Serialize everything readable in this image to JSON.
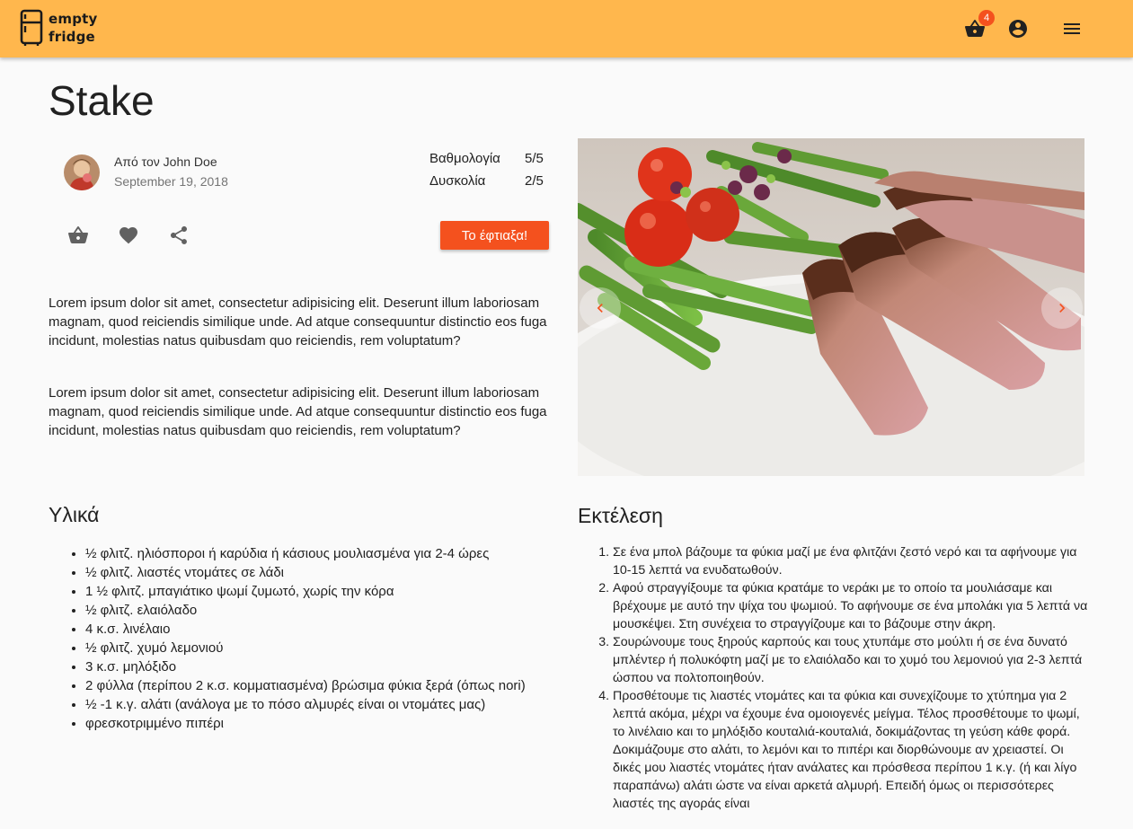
{
  "header": {
    "logo_line1": "empty",
    "logo_line2": "fridge",
    "cart_count": "4",
    "brand_color": "#ffb74d",
    "accent_color": "#f4511e",
    "icons": [
      "fridge-icon",
      "basket-icon",
      "account-icon",
      "menu-icon"
    ]
  },
  "recipe": {
    "title": "Stake",
    "author": "Από τον John Doe",
    "date": "September 19, 2018",
    "rating_label": "Βαθμολογία",
    "rating_value": "5/5",
    "difficulty_label": "Δυσκολία",
    "difficulty_value": "2/5",
    "made_it_label": "Το έφτιαξα!",
    "action_icons": [
      "basket-icon",
      "heart-icon",
      "share-icon"
    ],
    "description": [
      "Lorem ipsum dolor sit amet, consectetur adipisicing elit. Deserunt illum laboriosam magnam, quod reiciendis similique unde. Ad atque consequuntur distinctio eos fuga incidunt, molestias natus quibusdam quo reiciendis, rem voluptatum?",
      "Lorem ipsum dolor sit amet, consectetur adipisicing elit. Deserunt illum laboriosam magnam, quod reiciendis similique unde. Ad atque consequuntur distinctio eos fuga incidunt, molestias natus quibusdam quo reiciendis, rem voluptatum?"
    ]
  },
  "ingredients": {
    "heading": "Υλικά",
    "items": [
      "½ φλιτζ. ηλιόσποροι ή καρύδια ή κάσιους μουλιασμένα για 2-4 ώρες",
      "½ φλιτζ. λιαστές ντομάτες σε λάδι",
      "1 ½ φλιτζ. μπαγιάτικο ψωμί ζυμωτό, χωρίς την κόρα",
      "½ φλιτζ. ελαιόλαδο",
      "4 κ.σ. λινέλαιο",
      "½ φλιτζ. χυμό λεμονιού",
      "3 κ.σ. μηλόξιδο",
      "2 φύλλα (περίπου 2 κ.σ. κομματιασμένα) βρώσιμα φύκια ξερά (όπως nori)",
      "½ -1 κ.γ. αλάτι (ανάλογα με το πόσο αλμυρές είναι οι ντομάτες μας)",
      "φρεσκοτριμμένο πιπέρι"
    ]
  },
  "execution": {
    "heading": "Εκτέλεση",
    "steps": [
      "Σε ένα μπολ βάζουμε τα φύκια μαζί με ένα φλιτζάνι ζεστό νερό και τα αφήνουμε για 10-15 λεπτά να ενυδατωθούν.",
      "Αφού στραγγίξουμε τα φύκια κρατάμε το νεράκι με το οποίο τα μουλιάσαμε και βρέχουμε με αυτό την ψίχα του ψωμιού. Το αφήνουμε σε ένα μπολάκι για 5 λεπτά να μουσκέψει. Στη συνέχεια το στραγγίζουμε και το βάζουμε στην άκρη.",
      "Σουρώνουμε τους ξηρούς καρπούς και τους χτυπάμε στο μούλτι ή σε ένα δυνατό μπλέντερ ή πολυκόφτη μαζί με το ελαιόλαδο και το χυμό του λεμονιού για 2-3 λεπτά ώσπου να πολτοποιηθούν.",
      "Προσθέτουμε τις λιαστές ντομάτες και τα φύκια και συνεχίζουμε το χτύπημα για 2 λεπτά ακόμα, μέχρι να έχουμε ένα ομοιογενές μείγμα. Τέλος προσθέτουμε το ψωμί, το λινέλαιο και το μηλόξιδο κουταλιά-κουταλιά, δοκιμάζοντας τη γεύση κάθε φορά. Δοκιμάζουμε στο αλάτι, το λεμόνι και το πιπέρι και διορθώνουμε αν χρειαστεί. Οι δικές μου λιαστές ντομάτες ήταν ανάλατες και πρόσθεσα περίπου 1 κ.γ. (ή και λίγο παραπάνω) αλάτι ώστε να είναι αρκετά αλμυρή. Επειδή όμως οι περισσότερες λιαστές της αγοράς είναι"
    ]
  }
}
